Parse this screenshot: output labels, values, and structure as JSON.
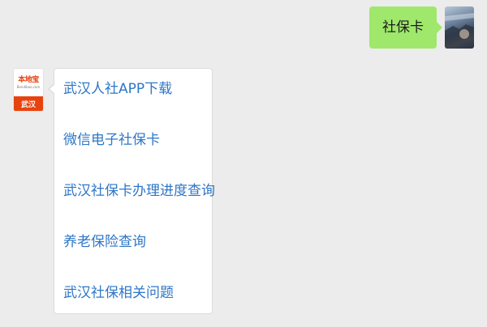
{
  "outgoing": {
    "text": "社保卡"
  },
  "bot": {
    "logo_text": "本地宝",
    "logo_sub": "Bendibao.com",
    "city": "武汉"
  },
  "links": [
    {
      "label": "武汉人社APP下载"
    },
    {
      "label": "微信电子社保卡"
    },
    {
      "label": "武汉社保卡办理进度查询"
    },
    {
      "label": "养老保险查询"
    },
    {
      "label": "武汉社保相关问题"
    }
  ],
  "colors": {
    "background": "#ececec",
    "outgoing_bubble": "#9fe86b",
    "link": "#2d76c7",
    "brand": "#e8430f"
  }
}
